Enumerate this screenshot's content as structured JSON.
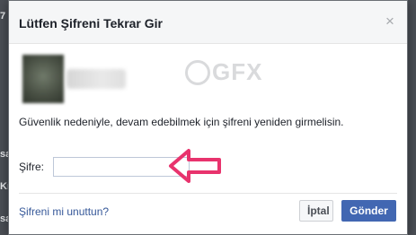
{
  "background": {
    "fragments": [
      "7",
      "sa",
      "Kı",
      "sa"
    ]
  },
  "dialog": {
    "title": "Lütfen Şifreni Tekrar Gir",
    "close_glyph": "×",
    "message": "Güvenlik nedeniyle, devam edebilmek için şifreni yeniden girmelisin.",
    "password_label": "Şifre:",
    "password_value": "",
    "forgot_link": "Şifreni mi unuttun?",
    "cancel_label": "İptal",
    "submit_label": "Gönder"
  },
  "watermark": {
    "text": "GFX"
  },
  "icons": {
    "close": "close-icon",
    "arrow": "left-arrow-icon"
  },
  "colors": {
    "primary_button": "#4267b2",
    "link": "#365899",
    "arrow": "#e8336d"
  }
}
